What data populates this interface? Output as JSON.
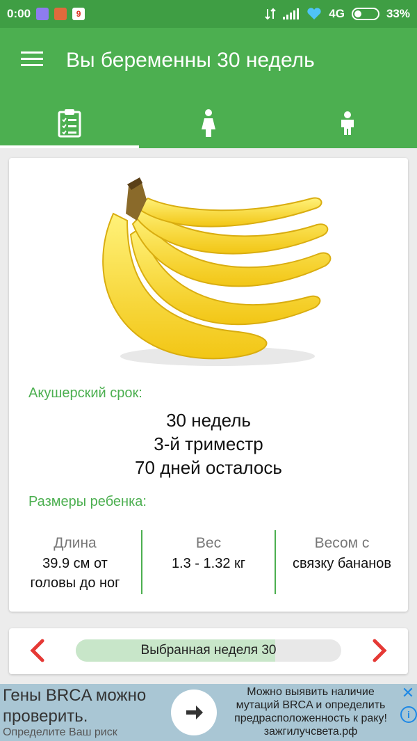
{
  "status_bar": {
    "time": "0:00",
    "network": "4G",
    "battery": "33%",
    "notification_icons": [
      "app-icon",
      "app-icon",
      "calendar-icon"
    ]
  },
  "app_bar": {
    "title": "Вы беременны 30 недель",
    "menu_icon": "hamburger-menu-icon"
  },
  "tabs": [
    {
      "icon": "clipboard-checklist-icon",
      "active": true
    },
    {
      "icon": "pregnant-woman-icon",
      "active": false
    },
    {
      "icon": "child-icon",
      "active": false
    }
  ],
  "card": {
    "image": "banana-bunch-illustration",
    "obstetric_label": "Акушерский срок:",
    "weeks": "30 недель",
    "trimester": "3-й триместр",
    "days_left": "70 дней осталось",
    "sizes_label": "Размеры ребенка:",
    "sizes": [
      {
        "heading": "Длина",
        "value_line1": "39.9 см от",
        "value_line2": "головы до ног"
      },
      {
        "heading": "Вес",
        "value_line1": "1.3 - 1.32 кг",
        "value_line2": ""
      },
      {
        "heading": "Весом с",
        "value_line1": "связку бананов",
        "value_line2": ""
      }
    ]
  },
  "week_selector": {
    "label": "Выбранная неделя 30",
    "progress": 0.75,
    "prev_icon": "chevron-left-icon",
    "next_icon": "chevron-right-icon"
  },
  "ad": {
    "title_line1": "Гены BRCA можно",
    "title_line2": "проверить.",
    "subtitle": "Определите Ваш риск",
    "text_line1": "Можно выявить наличие",
    "text_line2": "мутаций BRCA и определить",
    "text_line3": "предрасположенность к раку!",
    "domain": "зажгилучсвета.рф",
    "close_icon": "close-icon",
    "info_icon": "info-icon",
    "cta_icon": "arrow-right-icon"
  },
  "colors": {
    "primary": "#4caf50",
    "status_bar": "#3f9e44",
    "arrow": "#e53935",
    "ad_background": "#a9c6d4"
  }
}
